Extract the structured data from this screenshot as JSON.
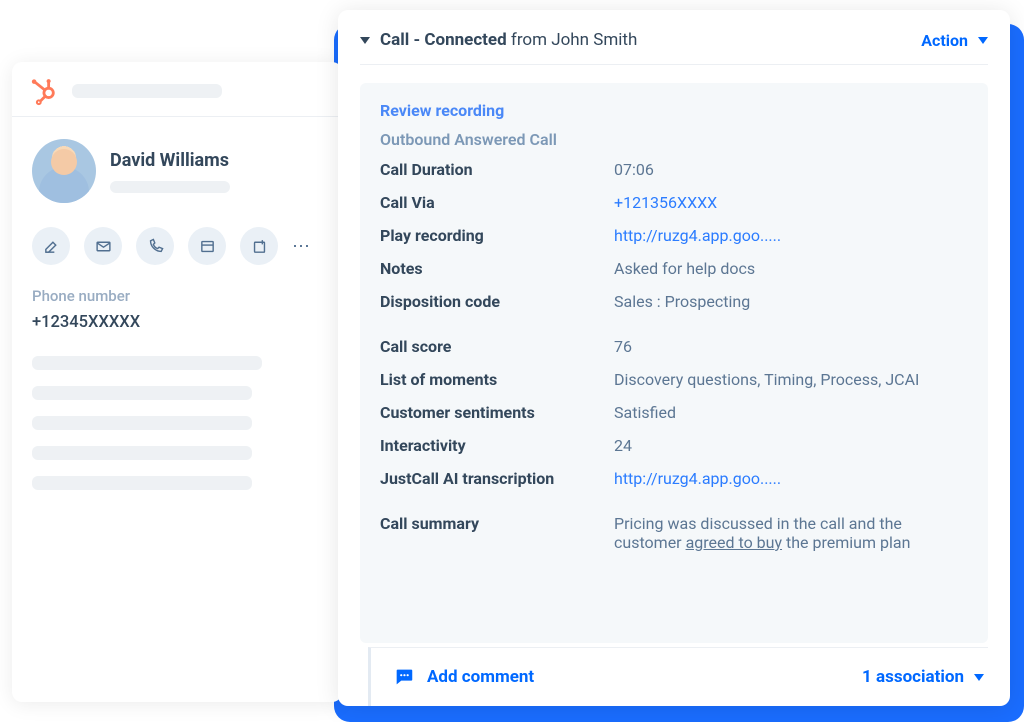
{
  "contact": {
    "name": "David Williams",
    "phone_label": "Phone number",
    "phone_value": "+12345XXXXX"
  },
  "panel": {
    "caret_icon": "caret-down",
    "title_bold": "Call - Connected",
    "title_from": " from John Smith",
    "action_label": "Action"
  },
  "details": {
    "review_recording": "Review recording",
    "call_type": "Outbound Answered Call",
    "rows": [
      {
        "k": "Call Duration",
        "v": "07:06",
        "link": false
      },
      {
        "k": "Call Via",
        "v": "+121356XXXX",
        "link": true
      },
      {
        "k": "Play recording",
        "v": "http://ruzg4.app.goo.....",
        "link": true
      },
      {
        "k": "Notes",
        "v": "Asked for help docs",
        "link": false
      },
      {
        "k": "Disposition code",
        "v": "Sales : Prospecting",
        "link": false
      }
    ],
    "rows2": [
      {
        "k": "Call score",
        "v": "76",
        "link": false
      },
      {
        "k": "List of moments",
        "v": "Discovery questions, Timing, Process, JCAI",
        "link": false
      },
      {
        "k": "Customer sentiments",
        "v": "Satisfied",
        "link": false
      },
      {
        "k": "Interactivity",
        "v": "24",
        "link": false
      },
      {
        "k": "JustCall AI transcription",
        "v": "http://ruzg4.app.goo.....",
        "link": true
      }
    ],
    "summary_key": "Call summary",
    "summary_pre": "Pricing was discussed in the call and the customer ",
    "summary_u": "agreed to buy",
    "summary_post": " the premium plan"
  },
  "footer": {
    "add_comment": "Add comment",
    "association": "1 association"
  }
}
